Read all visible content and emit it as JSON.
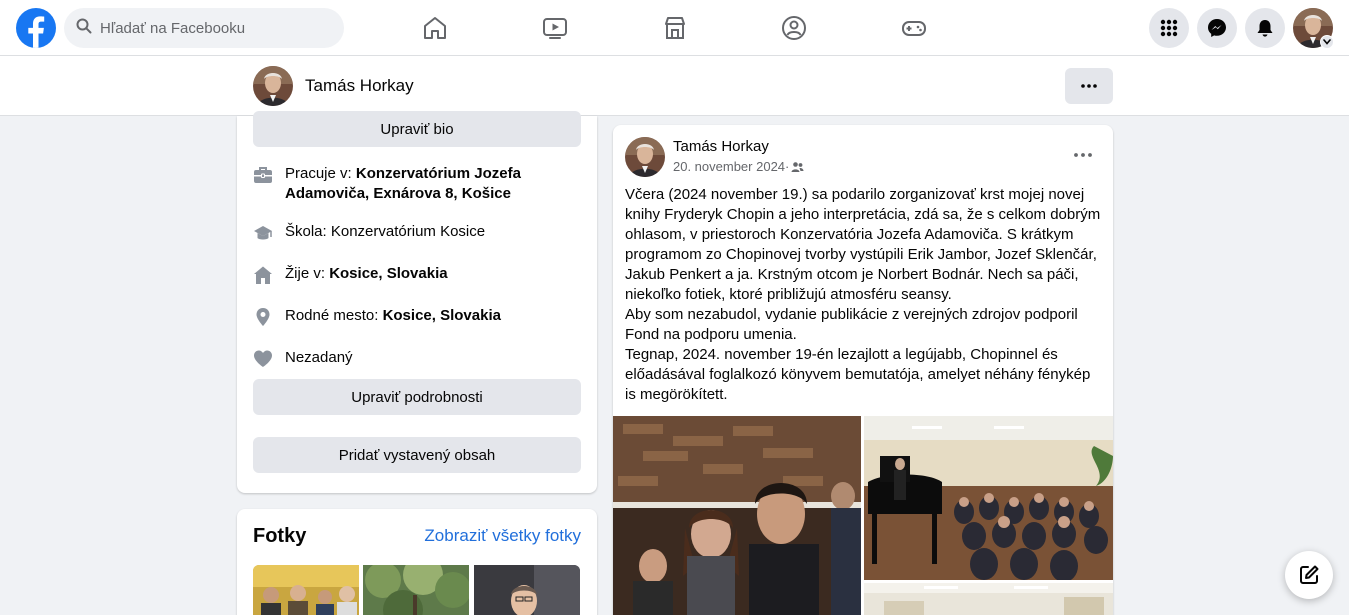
{
  "topbar": {
    "logo_icon": "facebook-logo",
    "search_placeholder": "Hľadať na Facebooku",
    "nav_icons": [
      "home-icon",
      "watch-icon",
      "marketplace-icon",
      "groups-icon",
      "gaming-icon"
    ],
    "right_icons": [
      "menu-grid-icon",
      "messenger-icon",
      "notifications-icon"
    ]
  },
  "profile_bar": {
    "name": "Tamás Horkay"
  },
  "intro": {
    "edit_bio": "Upraviť bio",
    "work_prefix": "Pracuje v: ",
    "work_place": "Konzervatórium Jozefa Adamoviča, Exnárova 8, Košice",
    "school": "Škola: Konzervatórium Kosice",
    "lives_prefix": "Žije v: ",
    "lives_place": "Kosice, Slovakia",
    "hometown_prefix": "Rodné mesto: ",
    "hometown_place": "Kosice, Slovakia",
    "relationship": "Nezadaný",
    "edit_details": "Upraviť podrobnosti",
    "add_featured": "Pridať vystavený obsah"
  },
  "photos": {
    "title": "Fotky",
    "see_all": "Zobraziť všetky fotky"
  },
  "post": {
    "author": "Tamás Horkay",
    "date": "20. november 2024",
    "separator": " · ",
    "paragraphs": [
      "Včera (2024 november 19.) sa podarilo zorganizovať krst mojej novej knihy Fryderyk Chopin a jeho interpretácia, zdá sa, že s celkom dobrým ohlasom, v priestoroch Konzervatória Jozefa Adamoviča. S krátkym programom zo Chopinovej tvorby vystúpili Erik Jambor, Jozef Sklenčár, Jakub Penkert a ja. Krstným otcom je Norbert Bodnár. Nech sa páči, niekoľko fotiek, ktoré približujú atmosféru seansy.",
      "Aby som nezabudol, vydanie publikácie z verejných zdrojov podporil Fond na podporu umenia.",
      "Tegnap, 2024. november 19-én lezajlott a legújabb, Chopinnel és előadásával foglalkozó könyvem bemutatója, amelyet néhány fénykép is megörökített."
    ]
  },
  "colors": {
    "brand": "#1877f2",
    "link": "#216fdb",
    "button_gray": "#e4e6eb",
    "page_bg": "#f0f2f5"
  }
}
